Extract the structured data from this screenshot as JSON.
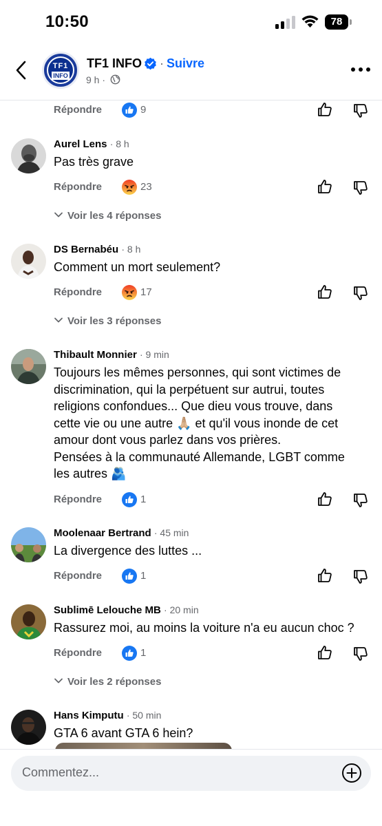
{
  "status_bar": {
    "time": "10:50",
    "battery": "78"
  },
  "header": {
    "page_name": "TF1 INFO",
    "separator": "·",
    "follow_label": "Suivre",
    "post_age": "9 h ·",
    "logo_text_top": "TF1",
    "logo_text_bottom": "INFO"
  },
  "labels": {
    "reply": "Répondre"
  },
  "top_partial": {
    "reaction": "like",
    "count": "9"
  },
  "comments": [
    {
      "author": "Aurel Lens",
      "time": "· 8 h",
      "text": "Pas très grave",
      "reaction": "angry",
      "count": "23",
      "replies_label": "Voir les 4 réponses"
    },
    {
      "author": "DS Bernabéu",
      "time": "· 8 h",
      "text": "Comment un mort seulement?",
      "reaction": "angry",
      "count": "17",
      "replies_label": "Voir les 3 réponses"
    },
    {
      "author": "Thibault Monnier",
      "time": "· 9 min",
      "text_lines": [
        "Toujours les mêmes personnes, qui sont victimes de",
        "discrimination, qui la perpétuent sur autrui, toutes",
        "religions confondues... Que dieu vous trouve, dans",
        "cette vie ou une autre 🙏🏼 et qu'il vous inonde de cet",
        "amour dont vous parlez dans vos prières.",
        "Pensées à la communauté Allemande, LGBT comme",
        "les autres 🫂"
      ],
      "reaction": "like",
      "count": "1"
    },
    {
      "author": "Moolenaar Bertrand",
      "time": "· 45 min",
      "text": "La divergence des luttes ...",
      "reaction": "like",
      "count": "1"
    },
    {
      "author": "Sublimē Lelouche MB",
      "time": "· 20 min",
      "text": "Rassurez moi, au moins la voiture n'a eu aucun choc ?",
      "reaction": "like",
      "count": "1",
      "replies_label": "Voir les 2 réponses"
    },
    {
      "author": "Hans Kimputu",
      "time": "· 50 min",
      "text": "GTA 6 avant GTA 6 hein?"
    }
  ],
  "composer": {
    "placeholder": "Commentez..."
  },
  "colors": {
    "accent": "#0866ff",
    "secondary_text": "#65676b",
    "composer_bg": "#f0f2f5",
    "like_blue": "#1877f2",
    "angry_orange": "#f0522b"
  }
}
